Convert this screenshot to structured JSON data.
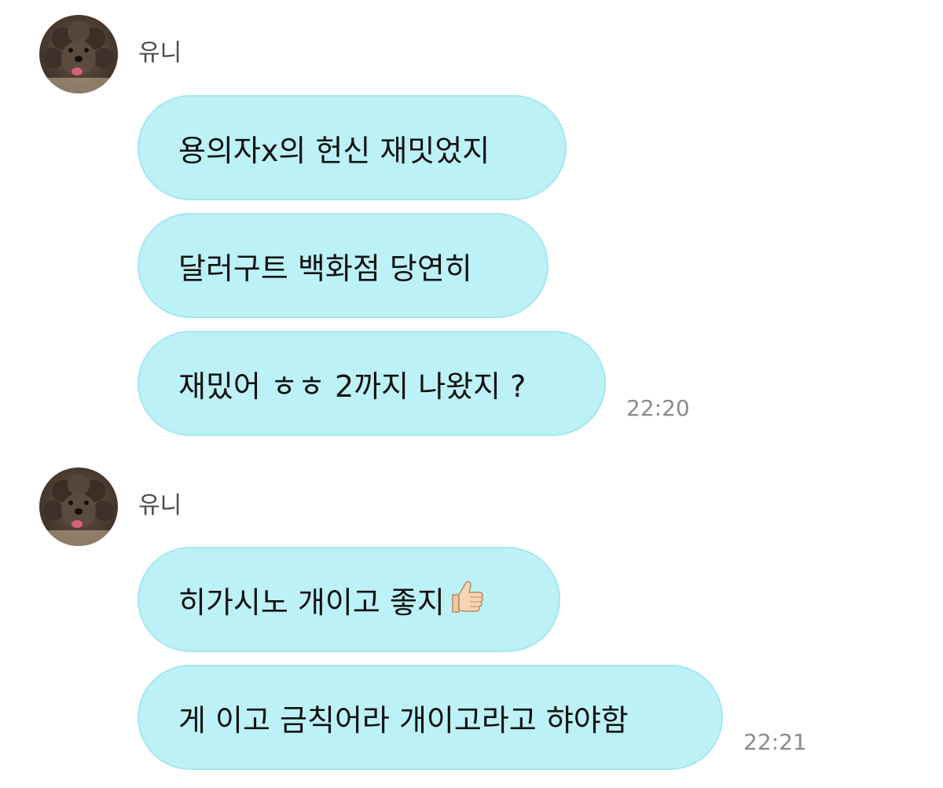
{
  "groups": [
    {
      "sender": "유니",
      "avatar_icon": "poodle-avatar",
      "messages": [
        "용의자x의 헌신 재밋었지",
        "달러구트 백화점 당연히",
        "재밌어 ㅎㅎ 2까지 나왔지 ?"
      ],
      "time": "22:20"
    },
    {
      "sender": "유니",
      "avatar_icon": "poodle-avatar",
      "messages": [
        "히가시노 개이고 좋지",
        "게 이고 금칙어라 개이고라고 햐야함"
      ],
      "time": "22:21",
      "emoji_icon": "thumbs-up-icon"
    }
  ],
  "colors": {
    "bubble": "#bcf1f5",
    "bubble_border": "#a6e7ee",
    "timestamp": "#8a8a8a",
    "sender": "#4a4a4a"
  }
}
